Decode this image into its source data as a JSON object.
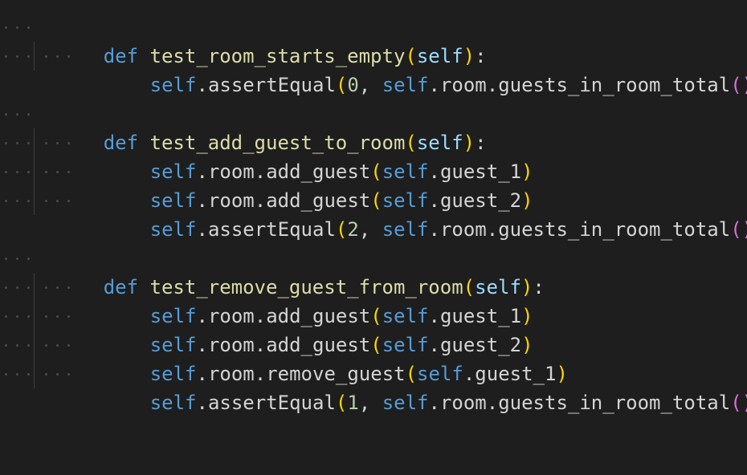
{
  "editor": {
    "theme_colors": {
      "background": "#1e1e1e",
      "keyword": "#569cd6",
      "function": "#dcdcaa",
      "self_param": "#9cdcfe",
      "text": "#d4d4d4",
      "number": "#b5cea8",
      "bracket_level_1": "#ffd700",
      "bracket_level_2": "#da70d6"
    },
    "lines": [
      {
        "kw": "def",
        "fn": "test_room_starts_empty",
        "lp": "(",
        "param": "self",
        "rp": ")",
        "colon": ":"
      },
      {
        "self": "self",
        "a": ".assertEqual",
        "lp": "(",
        "num": "0",
        "comma": ", ",
        "self2": "self",
        "b": ".room.guests_in_room_total",
        "lp2": "(",
        "rp2": ")",
        "rp": ")"
      },
      {},
      {
        "kw": "def",
        "fn": "test_add_guest_to_room",
        "lp": "(",
        "param": "self",
        "rp": ")",
        "colon": ":"
      },
      {
        "self": "self",
        "a": ".room.add_guest",
        "lp": "(",
        "self2": "self",
        "b": ".guest_1",
        "rp": ")"
      },
      {
        "self": "self",
        "a": ".room.add_guest",
        "lp": "(",
        "self2": "self",
        "b": ".guest_2",
        "rp": ")"
      },
      {
        "self": "self",
        "a": ".assertEqual",
        "lp": "(",
        "num": "2",
        "comma": ", ",
        "self2": "self",
        "b": ".room.guests_in_room_total",
        "lp2": "(",
        "rp2": ")",
        "rp": ")"
      },
      {},
      {
        "kw": "def",
        "fn": "test_remove_guest_from_room",
        "lp": "(",
        "param": "self",
        "rp": ")",
        "colon": ":"
      },
      {
        "self": "self",
        "a": ".room.add_guest",
        "lp": "(",
        "self2": "self",
        "b": ".guest_1",
        "rp": ")"
      },
      {
        "self": "self",
        "a": ".room.add_guest",
        "lp": "(",
        "self2": "self",
        "b": ".guest_2",
        "rp": ")"
      },
      {
        "self": "self",
        "a": ".room.remove_guest",
        "lp": "(",
        "self2": "self",
        "b": ".guest_1",
        "rp": ")"
      },
      {
        "self": "self",
        "a": ".assertEqual",
        "lp": "(",
        "num": "1",
        "comma": ", ",
        "self2": "self",
        "b": ".room.guests_in_room_total",
        "lp2": "(",
        "rp2": ")",
        "rp": ")"
      }
    ]
  }
}
